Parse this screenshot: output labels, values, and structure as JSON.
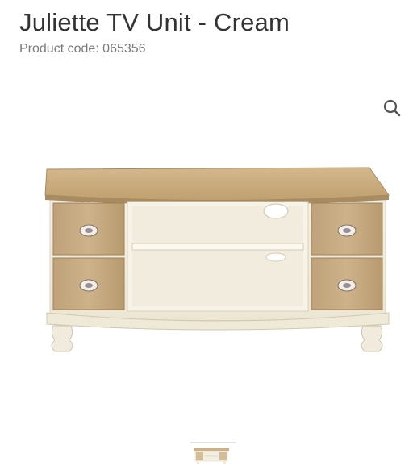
{
  "product": {
    "title": "Juliette TV Unit - Cream",
    "code_label": "Product code: 065356"
  },
  "icons": {
    "zoom": "search-icon"
  },
  "colors": {
    "title": "#333333",
    "code": "#7a7a7a",
    "wood": "#c9a97c",
    "cream": "#f3efe1"
  }
}
